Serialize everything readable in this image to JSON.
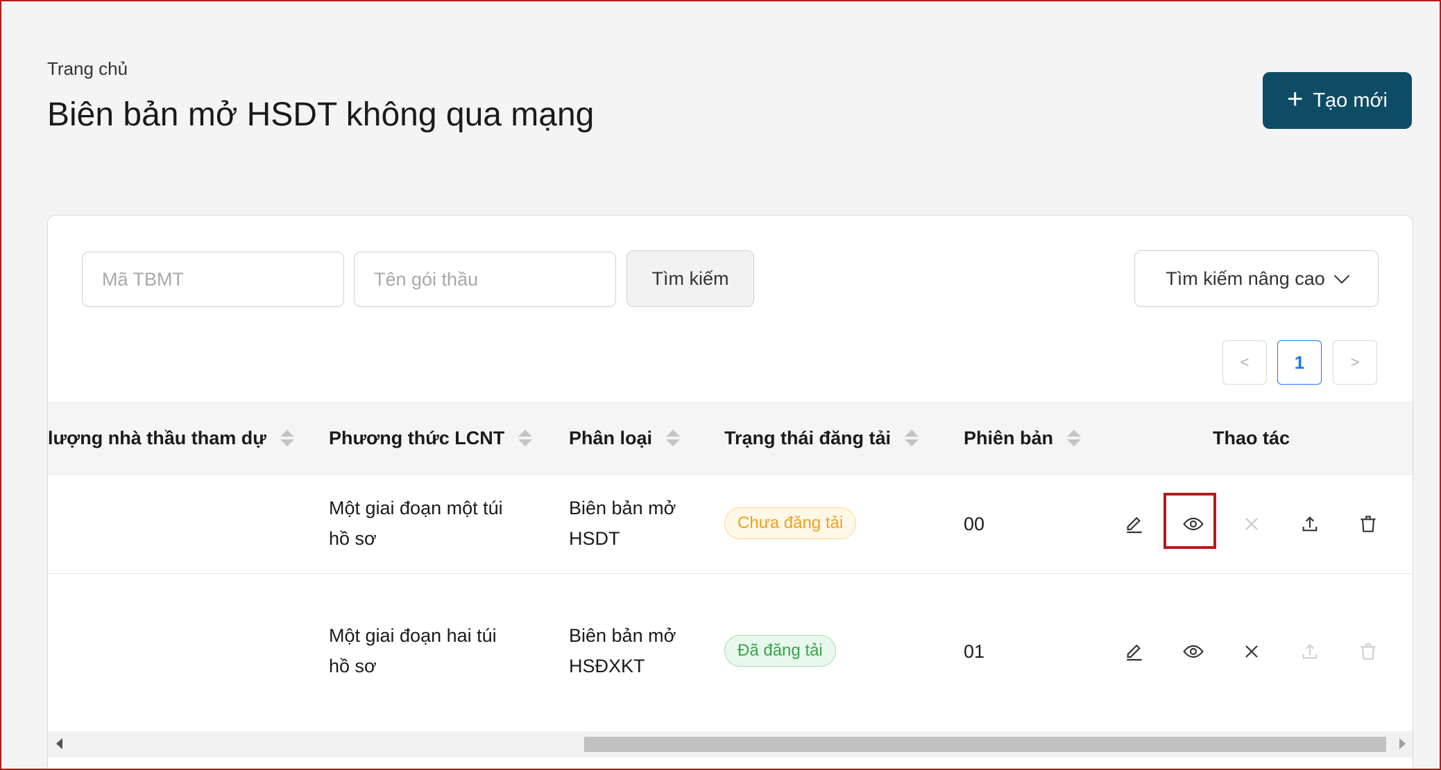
{
  "header": {
    "breadcrumb": "Trang chủ",
    "title": "Biên bản mở HSDT không qua mạng",
    "create_label": "Tạo mới"
  },
  "filters": {
    "code_placeholder": "Mã TBMT",
    "name_placeholder": "Tên gói thầu",
    "search_label": "Tìm kiếm",
    "advanced_label": "Tìm kiếm nâng cao"
  },
  "pagination": {
    "prev": "<",
    "current": "1",
    "next": ">"
  },
  "table": {
    "columns": {
      "bidders": "lượng nhà thầu tham dự",
      "method": "Phương thức LCNT",
      "category": "Phân loại",
      "status": "Trạng thái đăng tải",
      "version": "Phiên bản",
      "actions": "Thao tác"
    },
    "rows": [
      {
        "method_line1": "Một giai đoạn một túi",
        "method_line2": "hồ sơ",
        "category_line1": "Biên bản mở",
        "category_line2": "HSDT",
        "status": "Chưa đăng tải",
        "version": "00"
      },
      {
        "method_line1": "Một giai đoạn hai túi",
        "method_line2": "hồ sơ",
        "category_line1": "Biên bản mở",
        "category_line2": "HSĐXKT",
        "status": "Đã đăng tải",
        "version": "01"
      }
    ]
  },
  "colors": {
    "primary": "#0e4c66",
    "highlight": "#b31b1b",
    "pending": "#f0a020",
    "done": "#35a34a",
    "pager_active": "#1677ff"
  },
  "icons": [
    "plus-icon",
    "chevron-down-icon",
    "pencil-icon",
    "eye-icon",
    "close-icon",
    "upload-icon",
    "trash-icon"
  ]
}
